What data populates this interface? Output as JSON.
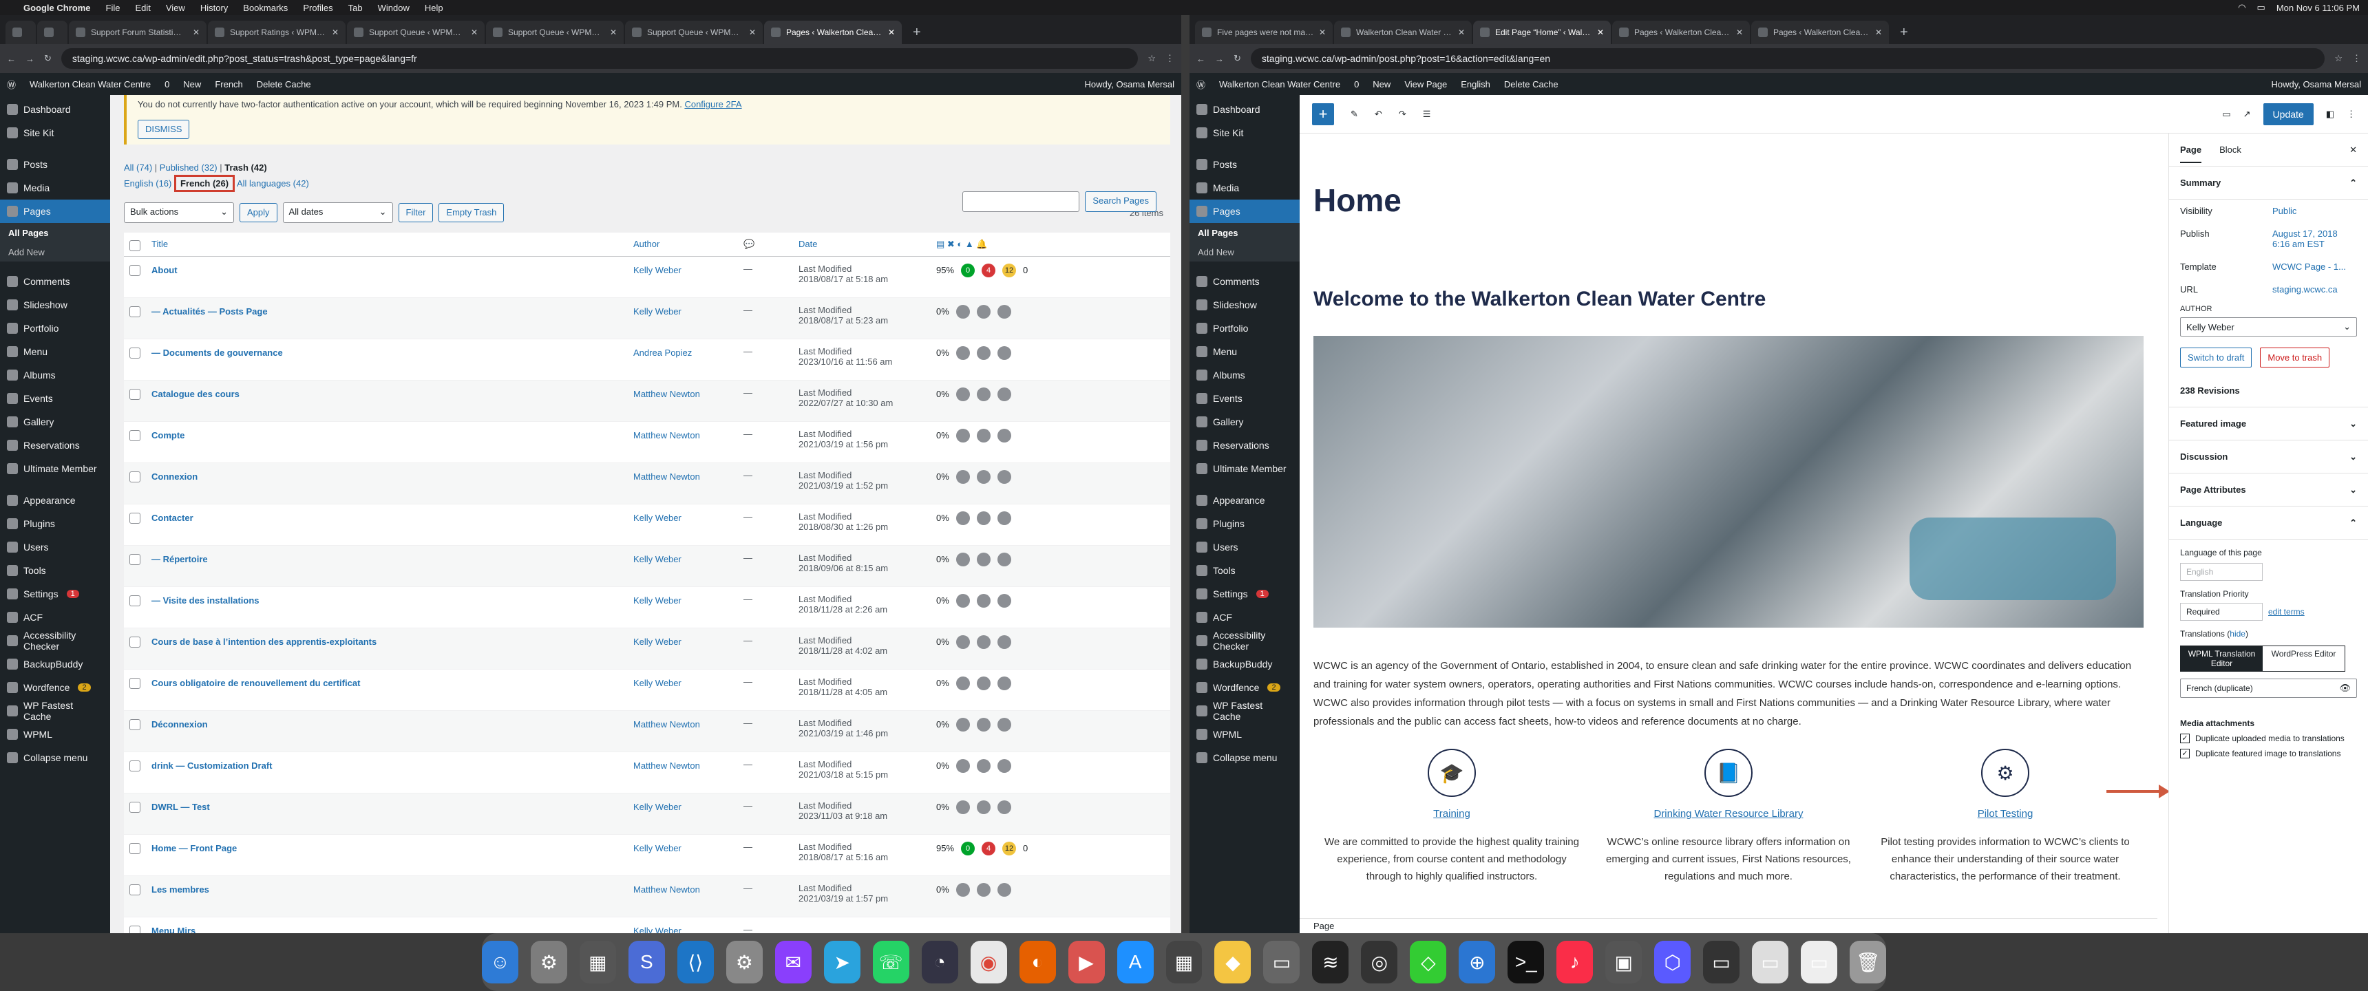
{
  "menubar": {
    "apple": "",
    "app": "Google Chrome",
    "items": [
      "File",
      "Edit",
      "View",
      "History",
      "Bookmarks",
      "Profiles",
      "Tab",
      "Window",
      "Help"
    ],
    "clock": "Mon Nov 6  11:06 PM"
  },
  "left": {
    "tabs": [
      "Support Forum Statisti…",
      "Support Ratings ‹ WPM…",
      "Support Queue ‹ WPM…",
      "Support Queue ‹ WPM…",
      "Support Queue ‹ WPM…",
      "Pages ‹ Walkerton Clea…"
    ],
    "url": "staging.wcwc.ca/wp-admin/edit.php?post_status=trash&post_type=page&lang=fr",
    "adminbar": {
      "site": "Walkerton Clean Water Centre",
      "comments": "0",
      "new": "New",
      "lang": "French",
      "cache": "Delete Cache",
      "howdy": "Howdy, Osama Mersal"
    },
    "menu": [
      {
        "label": "Dashboard"
      },
      {
        "label": "Site Kit"
      },
      {
        "label": "Posts"
      },
      {
        "label": "Media"
      },
      {
        "label": "Pages",
        "current": true
      },
      {
        "label": "Comments"
      },
      {
        "label": "Slideshow"
      },
      {
        "label": "Portfolio"
      },
      {
        "label": "Menu"
      },
      {
        "label": "Albums"
      },
      {
        "label": "Events"
      },
      {
        "label": "Gallery"
      },
      {
        "label": "Reservations"
      },
      {
        "label": "Ultimate Member"
      },
      {
        "label": "Appearance"
      },
      {
        "label": "Plugins"
      },
      {
        "label": "Users"
      },
      {
        "label": "Tools"
      },
      {
        "label": "Settings"
      },
      {
        "label": "ACF"
      },
      {
        "label": "Accessibility Checker"
      },
      {
        "label": "BackupBuddy"
      },
      {
        "label": "Wordfence"
      },
      {
        "label": "WP Fastest Cache"
      },
      {
        "label": "WPML"
      },
      {
        "label": "Collapse menu"
      }
    ],
    "submenu": [
      "All Pages",
      "Add New"
    ],
    "settings_badge": "1",
    "wordfence_badge": "2",
    "notice": "You do not currently have two-factor authentication active on your account, which will be required beginning November 16, 2023 1:49 PM.",
    "notice_link": "Configure 2FA",
    "dismiss": "DISMISS",
    "views": {
      "all": "All (74)",
      "published": "Published (32)",
      "trash": "Trash (42)"
    },
    "langs": {
      "english": "English (16)",
      "french": "French (26)",
      "all": "All languages (42)"
    },
    "search_btn": "Search Pages",
    "bulk": "Bulk actions",
    "apply": "Apply",
    "dates": "All dates",
    "filter": "Filter",
    "empty_trash": "Empty Trash",
    "count": "26 items",
    "cols": {
      "title": "Title",
      "author": "Author",
      "date": "Date"
    },
    "rows": [
      {
        "title": "About",
        "author": "Kelly Weber",
        "dash": "—",
        "status": "Last Modified",
        "date": "2018/08/17 at 5:18 am",
        "pct": "95%",
        "a": "0",
        "b": "4",
        "c": "12",
        "d": "0"
      },
      {
        "title": "— Actualités — Posts Page",
        "author": "Kelly Weber",
        "dash": "—",
        "status": "Last Modified",
        "date": "2018/08/17 at 5:23 am",
        "pct": "0%"
      },
      {
        "title": "— Documents de gouvernance",
        "author": "Andrea Popiez",
        "dash": "—",
        "status": "Last Modified",
        "date": "2023/10/16 at 11:56 am",
        "pct": "0%"
      },
      {
        "title": "Catalogue des cours",
        "author": "Matthew Newton",
        "dash": "—",
        "status": "Last Modified",
        "date": "2022/07/27 at 10:30 am",
        "pct": "0%"
      },
      {
        "title": "Compte",
        "author": "Matthew Newton",
        "dash": "—",
        "status": "Last Modified",
        "date": "2021/03/19 at 1:56 pm",
        "pct": "0%"
      },
      {
        "title": "Connexion",
        "author": "Matthew Newton",
        "dash": "—",
        "status": "Last Modified",
        "date": "2021/03/19 at 1:52 pm",
        "pct": "0%"
      },
      {
        "title": "Contacter",
        "author": "Kelly Weber",
        "dash": "—",
        "status": "Last Modified",
        "date": "2018/08/30 at 1:26 pm",
        "pct": "0%"
      },
      {
        "title": "— Répertoire",
        "author": "Kelly Weber",
        "dash": "—",
        "status": "Last Modified",
        "date": "2018/09/06 at 8:15 am",
        "pct": "0%"
      },
      {
        "title": "— Visite des installations",
        "author": "Kelly Weber",
        "dash": "—",
        "status": "Last Modified",
        "date": "2018/11/28 at 2:26 am",
        "pct": "0%"
      },
      {
        "title": "Cours de base à l’intention des apprentis-exploitants",
        "author": "Kelly Weber",
        "dash": "—",
        "status": "Last Modified",
        "date": "2018/11/28 at 4:02 am",
        "pct": "0%"
      },
      {
        "title": "Cours obligatoire de renouvellement du certificat",
        "author": "Kelly Weber",
        "dash": "—",
        "status": "Last Modified",
        "date": "2018/11/28 at 4:05 am",
        "pct": "0%"
      },
      {
        "title": "Déconnexion",
        "author": "Matthew Newton",
        "dash": "—",
        "status": "Last Modified",
        "date": "2021/03/19 at 1:46 pm",
        "pct": "0%"
      },
      {
        "title": "drink — Customization Draft",
        "author": "Matthew Newton",
        "dash": "—",
        "status": "Last Modified",
        "date": "2021/03/18 at 5:15 pm",
        "pct": "0%"
      },
      {
        "title": "DWRL — Test",
        "author": "Kelly Weber",
        "dash": "—",
        "status": "Last Modified",
        "date": "2023/11/03 at 9:18 am",
        "pct": "0%"
      },
      {
        "title": "Home — Front Page",
        "author": "Kelly Weber",
        "dash": "—",
        "status": "Last Modified",
        "date": "2018/08/17 at 5:16 am",
        "pct": "95%",
        "a": "0",
        "b": "4",
        "c": "12",
        "d": "0"
      },
      {
        "title": "Les membres",
        "author": "Matthew Newton",
        "dash": "—",
        "status": "Last Modified",
        "date": "2021/03/19 at 1:57 pm",
        "pct": "0%"
      },
      {
        "title": "Menu Mirs",
        "author": "Kelly Weber",
        "dash": "—",
        "status": "",
        "date": "",
        "pct": ""
      }
    ]
  },
  "right": {
    "tabs": [
      "Five pages were not made du…",
      "Walkerton Clean Water Centre",
      "Edit Page “Home” ‹ Walkerto…",
      "Pages ‹ Walkerton Clean Wat…",
      "Pages ‹ Walkerton Clean Wat…"
    ],
    "url": "staging.wcwc.ca/wp-admin/post.php?post=16&action=edit&lang=en",
    "adminbar": {
      "site": "Walkerton Clean Water Centre",
      "comments": "0",
      "new": "New",
      "view": "View Page",
      "lang": "English",
      "cache": "Delete Cache",
      "howdy": "Howdy, Osama Mersal"
    },
    "update": "Update",
    "h1": "Home",
    "h2": "Welcome to the Walkerton Clean Water Centre",
    "para": "WCWC is an agency of the Government of Ontario, established in 2004, to ensure clean and safe drinking water for the entire province. WCWC coordinates and delivers education and training for water system owners, operators, operating authorities and First Nations communities. WCWC courses include hands-on, correspondence and e-learning options. WCWC also provides information through pilot tests — with a focus on systems in small and First Nations communities — and a Drinking Water Resource Library, where water professionals and the public can access fact sheets, how-to videos and reference documents at no charge.",
    "cols": [
      {
        "link": "Training",
        "text": "We are committed to provide the highest quality training experience, from course content and methodology through to highly qualified instructors."
      },
      {
        "link": "Drinking Water Resource Library",
        "text": "WCWC’s online resource library offers information on emerging and current issues, First Nations resources, regulations and much more."
      },
      {
        "link": "Pilot Testing",
        "text": "Pilot testing provides information to WCWC’s clients to enhance their understanding of their source water characteristics, the performance of their treatment."
      }
    ],
    "statusbar": "Page",
    "settings": {
      "tab_page": "Page",
      "tab_block": "Block",
      "summary": "Summary",
      "visibility_k": "Visibility",
      "visibility_v": "Public",
      "publish_k": "Publish",
      "publish_v": "August 17, 2018 6:16 am EST",
      "template_k": "Template",
      "template_v": "WCWC Page - 1...",
      "url_k": "URL",
      "url_v": "staging.wcwc.ca",
      "author_lbl": "AUTHOR",
      "author_v": "Kelly Weber",
      "draft": "Switch to draft",
      "trash": "Move to trash",
      "revisions": "238 Revisions",
      "featured": "Featured image",
      "discussion": "Discussion",
      "attributes": "Page Attributes",
      "language": "Language",
      "lang_of_page": "Language of this page",
      "lang_val": "English",
      "priority": "Translation Priority",
      "priority_val": "Required",
      "edit_terms": "edit terms",
      "translations": "Translations",
      "hide": "hide",
      "wpml_editor": "WPML Translation Editor",
      "wp_editor": "WordPress Editor",
      "french_dup": "French (duplicate)",
      "media": "Media attachments",
      "dup_media": "Duplicate uploaded media to translations",
      "dup_featured": "Duplicate featured image to translations"
    }
  },
  "colors": {
    "wp_blue": "#2271b1",
    "admin_dark": "#1d2327",
    "highlight": "#cf3d2e"
  }
}
